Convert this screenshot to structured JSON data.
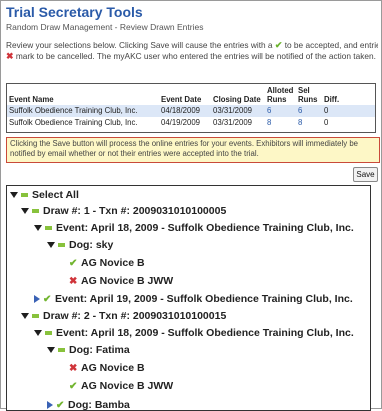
{
  "header": {
    "title": "Trial Secretary Tools",
    "subtitle": "Random Draw Management - Review Drawn Entries"
  },
  "intro": {
    "line1_pre": "Review your selections below. Clicking Save will cause the entries with a ",
    "line1_post": " to be accepted, and entries with a",
    "line2_post": " mark to be cancelled. The myAKC user who entered the entries will be notified of the action taken."
  },
  "table": {
    "headers": {
      "event_name": "Event Name",
      "event_date": "Event Date",
      "closing_date": "Closing Date",
      "alloted_runs": "Alloted Runs",
      "sel_runs": "Sel Runs",
      "diff": "Diff."
    },
    "rows": [
      {
        "event_name": "Suffolk Obedience Training Club, Inc.",
        "event_date": "04/18/2009",
        "closing_date": "03/31/2009",
        "alloted": "6",
        "sel": "6",
        "diff": "0"
      },
      {
        "event_name": "Suffolk Obedience Training Club, Inc.",
        "event_date": "04/19/2009",
        "closing_date": "03/31/2009",
        "alloted": "8",
        "sel": "8",
        "diff": "0"
      }
    ]
  },
  "notice": "Clicking the Save button will process the online entries for your events. Exhibitors will immediately be notified by email whether or not their entries were accepted into the trial.",
  "save_label": "Save",
  "tree": {
    "select_all": "Select All",
    "draw1": "Draw #: 1 - Txn #: 2009031010100005",
    "draw1_event1": "Event: April 18, 2009 - Suffolk Obedience Training Club, Inc.",
    "draw1_dog": "Dog: sky",
    "draw1_entry1": "AG Novice B",
    "draw1_entry2": "AG Novice B JWW",
    "draw1_event2": "Event: April 19, 2009 - Suffolk Obedience Training Club, Inc.",
    "draw2": "Draw #: 2 - Txn #: 2009031010100015",
    "draw2_event1": "Event: April 18, 2009 - Suffolk Obedience Training Club, Inc.",
    "draw2_dog1": "Dog: Fatima",
    "draw2_entry1": "AG Novice B",
    "draw2_entry2": "AG Novice B JWW",
    "draw2_dog2": "Dog: Bamba"
  },
  "colors": {
    "title_blue": "#2a5aa8",
    "accept_green": "#72b530",
    "cancel_red": "#d0343a",
    "notice_bg": "#fdf7c6",
    "row_highlight": "#dce7f7"
  }
}
